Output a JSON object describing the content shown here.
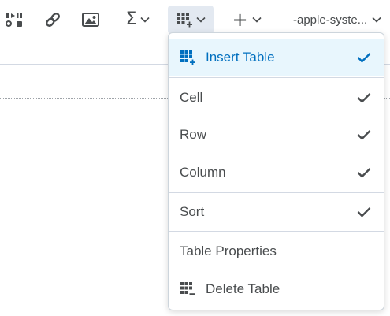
{
  "toolbar": {
    "buttons": [
      {
        "name": "media-button",
        "icon": "play-pause-icon"
      },
      {
        "name": "link-button",
        "icon": "link-icon"
      },
      {
        "name": "image-button",
        "icon": "image-icon"
      },
      {
        "name": "equation-button",
        "icon": "sigma-icon",
        "glyph": "Σ"
      },
      {
        "name": "table-button",
        "icon": "table-icon",
        "active": true
      },
      {
        "name": "insert-button",
        "icon": "plus-icon",
        "glyph": "+"
      }
    ],
    "font_select": {
      "value": "-apple-syste..."
    }
  },
  "table_menu": {
    "items": [
      {
        "label": "Insert Table",
        "icon": "insert-table-icon",
        "checked": true,
        "highlighted": true
      },
      {
        "label": "Cell",
        "checked": true
      },
      {
        "label": "Row",
        "checked": true
      },
      {
        "label": "Column",
        "checked": true
      },
      {
        "label": "Sort",
        "checked": true
      },
      {
        "label": "Table Properties",
        "checked": false
      },
      {
        "label": "Delete Table",
        "icon": "delete-table-icon",
        "checked": false
      }
    ]
  },
  "colors": {
    "accent": "#006fbf",
    "highlight_bg": "#e8f6fd",
    "icon": "#494c4e",
    "text": "#494c4e",
    "active_button_bg": "#e3e9f1",
    "separator": "#d3d9e3"
  }
}
